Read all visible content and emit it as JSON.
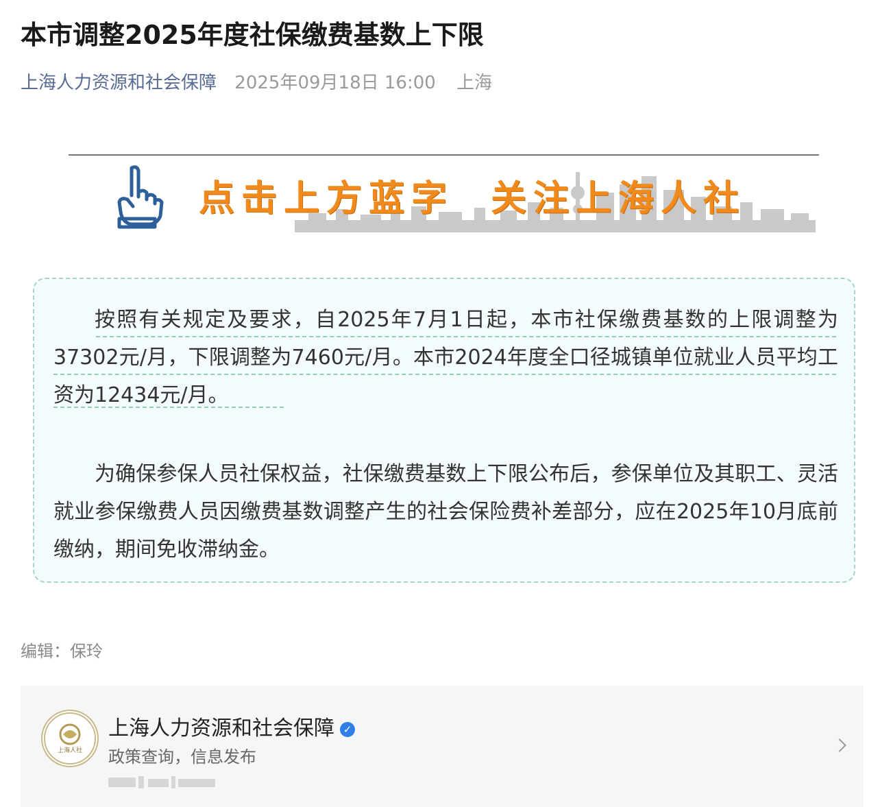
{
  "article": {
    "title": "本市调整2025年度社保缴费基数上下限",
    "source": "上海人力资源和社会保障",
    "date": "2025年09月18日 16:00",
    "location": "上海"
  },
  "banner": {
    "slogan_left": "点击上方蓝字",
    "slogan_right": "关注上海人社",
    "accent_color": "#f08a1c",
    "hand_icon": "pointing-hand-icon"
  },
  "notice": {
    "paragraph_1": "按照有关规定及要求，自2025年7月1日起，本市社保缴费基数的上限调整为37302元/月，下限调整为7460元/月。本市2024年度全口径城镇单位就业人员平均工资为12434元/月。",
    "paragraph_2": "为确保参保人员社保权益，社保缴费基数上下限公布后，参保单位及其职工、灵活就业参保缴费人员因缴费基数调整产生的社会保险费补差部分，应在2025年10月底前缴纳，期间免收滞纳金。"
  },
  "editor": {
    "text": "编辑：保玲"
  },
  "account_card": {
    "logo_text": "上海人社",
    "name": "上海人力资源和社会保障",
    "description": "政策查询，信息发布",
    "verified_icon": "verified-badge-icon",
    "chevron_icon": "chevron-right-icon"
  }
}
